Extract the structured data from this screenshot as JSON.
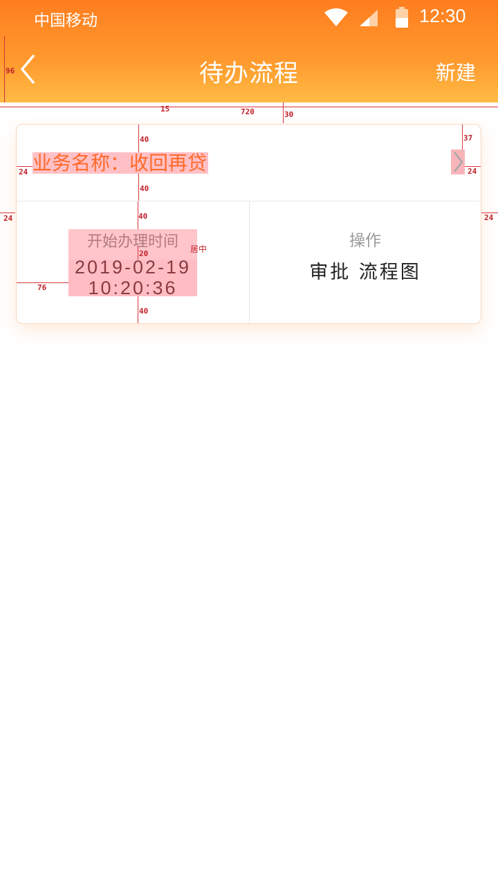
{
  "status_bar": {
    "carrier": "中国移动",
    "time": "12:30",
    "icons": [
      "wifi-icon",
      "signal-icon",
      "battery-icon"
    ]
  },
  "nav": {
    "title": "待办流程",
    "new_label": "新建",
    "back_icon": "chevron-left-icon"
  },
  "card": {
    "business_name": "业务名称：收回再贷",
    "start_time_label": "开始办理时间",
    "start_date": "2019-02-19",
    "start_clock": "10:20:36",
    "operation_label": "操作",
    "approve_label": "审批",
    "flowchart_label": "流程图",
    "chevron_icon": "chevron-right-icon"
  },
  "annotations": {
    "nav_height": "96",
    "gap": "15",
    "width": "720",
    "card_top": "30",
    "pad_top": "40",
    "pad_bottom": "40",
    "side_24_a": "24",
    "side_24_b": "24",
    "side_24_c": "24",
    "side_24_d": "24",
    "right_37": "37",
    "col_top": "40",
    "line_gap": "20",
    "col_bottom": "40",
    "left_76": "76",
    "center_note": "居中"
  },
  "colors": {
    "header_top": "#ff7d1f",
    "header_bottom": "#ffbb45",
    "accent": "#ff6a2b"
  }
}
